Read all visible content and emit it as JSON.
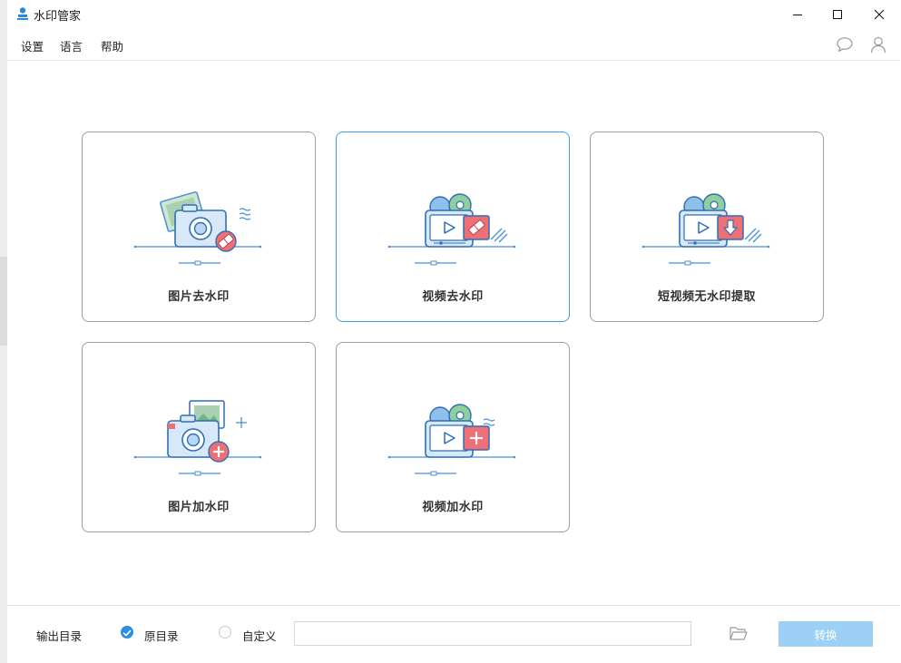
{
  "app": {
    "title": "水印管家",
    "accent": "#2a8fe5"
  },
  "menu": {
    "items": [
      "设置",
      "语言",
      "帮助"
    ]
  },
  "cards": [
    {
      "label": "图片去水印",
      "icon": "photo-camera-eraser-icon"
    },
    {
      "label": "视频去水印",
      "icon": "video-player-eraser-icon"
    },
    {
      "label": "短视频无水印提取",
      "icon": "video-download-icon"
    },
    {
      "label": "图片加水印",
      "icon": "photo-camera-add-icon"
    },
    {
      "label": "视频加水印",
      "icon": "video-player-add-icon"
    }
  ],
  "bottom": {
    "output_label": "输出目录",
    "option_original": "原目录",
    "option_custom": "自定义",
    "path_value": "",
    "convert_label": "转换"
  }
}
